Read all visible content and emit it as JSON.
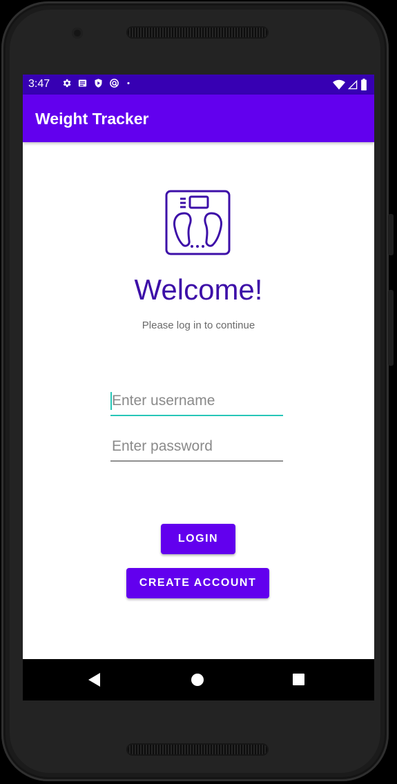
{
  "status_bar": {
    "time": "3:47",
    "left_icons": [
      "gear-icon",
      "message-icon",
      "shield-icon",
      "sync-icon",
      "dot-icon"
    ],
    "right_icons": [
      "wifi-icon",
      "signal-icon",
      "battery-icon"
    ]
  },
  "app_bar": {
    "title": "Weight Tracker"
  },
  "login": {
    "logo_icon": "scale-icon",
    "welcome": "Welcome!",
    "subtitle": "Please log in to continue",
    "username": {
      "value": "",
      "placeholder": "Enter username"
    },
    "password": {
      "value": "",
      "placeholder": "Enter password"
    },
    "login_label": "LOGIN",
    "create_account_label": "CREATE ACCOUNT"
  },
  "colors": {
    "status_bar": "#3700b3",
    "app_bar": "#6200ee",
    "primary": "#6200ee",
    "welcome_text": "#3d0fa8",
    "focus_accent": "#26c6b7"
  },
  "nav_bar": {
    "icons": [
      "back-icon",
      "home-icon",
      "recents-icon"
    ]
  }
}
